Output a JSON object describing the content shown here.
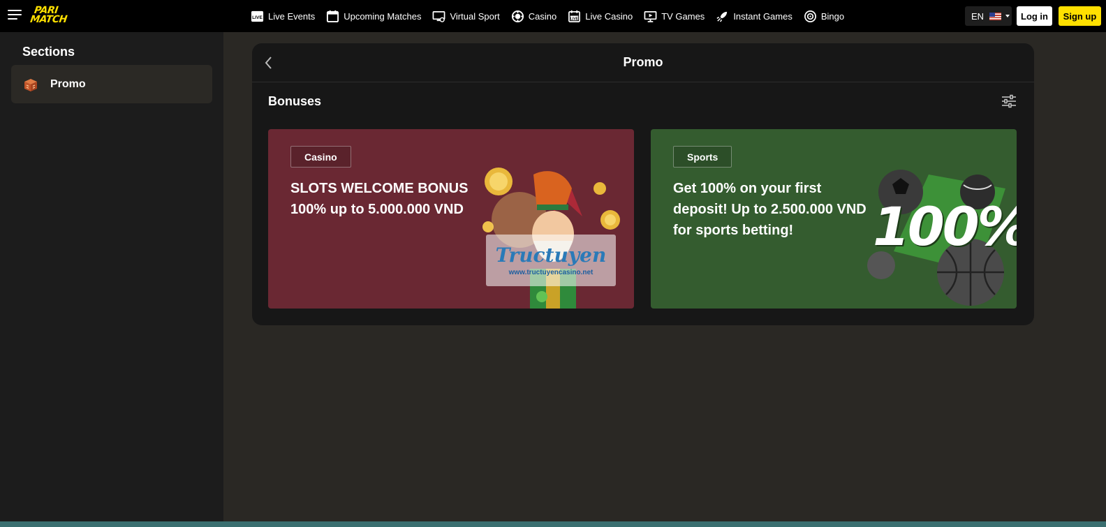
{
  "header": {
    "logo_line1": "PARI",
    "logo_line2": "MATCH",
    "nav": [
      {
        "label": "Live Events",
        "icon": "live-icon"
      },
      {
        "label": "Upcoming Matches",
        "icon": "calendar-icon"
      },
      {
        "label": "Virtual Sport",
        "icon": "monitor-icon"
      },
      {
        "label": "Casino",
        "icon": "chip-icon"
      },
      {
        "label": "Live Casino",
        "icon": "live-casino-icon"
      },
      {
        "label": "TV Games",
        "icon": "tv-icon"
      },
      {
        "label": "Instant Games",
        "icon": "rocket-icon"
      },
      {
        "label": "Bingo",
        "icon": "bingo-icon"
      }
    ],
    "language": "EN",
    "login_label": "Log in",
    "signup_label": "Sign up",
    "brand_color": "#ffe000"
  },
  "sidebar": {
    "title": "Sections",
    "items": [
      {
        "label": "Promo",
        "icon": "gift-box-icon"
      }
    ]
  },
  "main": {
    "title": "Promo",
    "section_title": "Bonuses",
    "cards": [
      {
        "tag": "Casino",
        "headline": "SLOTS WELCOME BONUS 100% up to 5.000.000 VND",
        "color": "#6a2833",
        "watermark_title": "Tructuyen",
        "watermark_url": "www.tructuyencasino.net"
      },
      {
        "tag": "Sports",
        "headline": "Get 100% on your first deposit! Up to 2.500.000 VND for sports betting!",
        "color": "#345c2f",
        "art_text": "100%"
      }
    ]
  }
}
